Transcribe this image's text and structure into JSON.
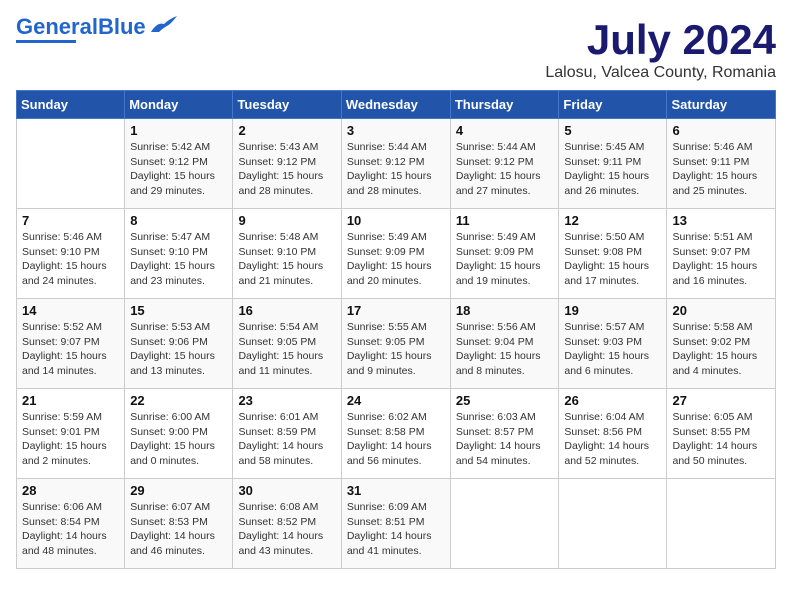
{
  "logo": {
    "text1": "General",
    "text2": "Blue"
  },
  "title": "July 2024",
  "subtitle": "Lalosu, Valcea County, Romania",
  "days_of_week": [
    "Sunday",
    "Monday",
    "Tuesday",
    "Wednesday",
    "Thursday",
    "Friday",
    "Saturday"
  ],
  "weeks": [
    [
      {
        "day": "",
        "info": ""
      },
      {
        "day": "1",
        "info": "Sunrise: 5:42 AM\nSunset: 9:12 PM\nDaylight: 15 hours\nand 29 minutes."
      },
      {
        "day": "2",
        "info": "Sunrise: 5:43 AM\nSunset: 9:12 PM\nDaylight: 15 hours\nand 28 minutes."
      },
      {
        "day": "3",
        "info": "Sunrise: 5:44 AM\nSunset: 9:12 PM\nDaylight: 15 hours\nand 28 minutes."
      },
      {
        "day": "4",
        "info": "Sunrise: 5:44 AM\nSunset: 9:12 PM\nDaylight: 15 hours\nand 27 minutes."
      },
      {
        "day": "5",
        "info": "Sunrise: 5:45 AM\nSunset: 9:11 PM\nDaylight: 15 hours\nand 26 minutes."
      },
      {
        "day": "6",
        "info": "Sunrise: 5:46 AM\nSunset: 9:11 PM\nDaylight: 15 hours\nand 25 minutes."
      }
    ],
    [
      {
        "day": "7",
        "info": "Sunrise: 5:46 AM\nSunset: 9:10 PM\nDaylight: 15 hours\nand 24 minutes."
      },
      {
        "day": "8",
        "info": "Sunrise: 5:47 AM\nSunset: 9:10 PM\nDaylight: 15 hours\nand 23 minutes."
      },
      {
        "day": "9",
        "info": "Sunrise: 5:48 AM\nSunset: 9:10 PM\nDaylight: 15 hours\nand 21 minutes."
      },
      {
        "day": "10",
        "info": "Sunrise: 5:49 AM\nSunset: 9:09 PM\nDaylight: 15 hours\nand 20 minutes."
      },
      {
        "day": "11",
        "info": "Sunrise: 5:49 AM\nSunset: 9:09 PM\nDaylight: 15 hours\nand 19 minutes."
      },
      {
        "day": "12",
        "info": "Sunrise: 5:50 AM\nSunset: 9:08 PM\nDaylight: 15 hours\nand 17 minutes."
      },
      {
        "day": "13",
        "info": "Sunrise: 5:51 AM\nSunset: 9:07 PM\nDaylight: 15 hours\nand 16 minutes."
      }
    ],
    [
      {
        "day": "14",
        "info": "Sunrise: 5:52 AM\nSunset: 9:07 PM\nDaylight: 15 hours\nand 14 minutes."
      },
      {
        "day": "15",
        "info": "Sunrise: 5:53 AM\nSunset: 9:06 PM\nDaylight: 15 hours\nand 13 minutes."
      },
      {
        "day": "16",
        "info": "Sunrise: 5:54 AM\nSunset: 9:05 PM\nDaylight: 15 hours\nand 11 minutes."
      },
      {
        "day": "17",
        "info": "Sunrise: 5:55 AM\nSunset: 9:05 PM\nDaylight: 15 hours\nand 9 minutes."
      },
      {
        "day": "18",
        "info": "Sunrise: 5:56 AM\nSunset: 9:04 PM\nDaylight: 15 hours\nand 8 minutes."
      },
      {
        "day": "19",
        "info": "Sunrise: 5:57 AM\nSunset: 9:03 PM\nDaylight: 15 hours\nand 6 minutes."
      },
      {
        "day": "20",
        "info": "Sunrise: 5:58 AM\nSunset: 9:02 PM\nDaylight: 15 hours\nand 4 minutes."
      }
    ],
    [
      {
        "day": "21",
        "info": "Sunrise: 5:59 AM\nSunset: 9:01 PM\nDaylight: 15 hours\nand 2 minutes."
      },
      {
        "day": "22",
        "info": "Sunrise: 6:00 AM\nSunset: 9:00 PM\nDaylight: 15 hours\nand 0 minutes."
      },
      {
        "day": "23",
        "info": "Sunrise: 6:01 AM\nSunset: 8:59 PM\nDaylight: 14 hours\nand 58 minutes."
      },
      {
        "day": "24",
        "info": "Sunrise: 6:02 AM\nSunset: 8:58 PM\nDaylight: 14 hours\nand 56 minutes."
      },
      {
        "day": "25",
        "info": "Sunrise: 6:03 AM\nSunset: 8:57 PM\nDaylight: 14 hours\nand 54 minutes."
      },
      {
        "day": "26",
        "info": "Sunrise: 6:04 AM\nSunset: 8:56 PM\nDaylight: 14 hours\nand 52 minutes."
      },
      {
        "day": "27",
        "info": "Sunrise: 6:05 AM\nSunset: 8:55 PM\nDaylight: 14 hours\nand 50 minutes."
      }
    ],
    [
      {
        "day": "28",
        "info": "Sunrise: 6:06 AM\nSunset: 8:54 PM\nDaylight: 14 hours\nand 48 minutes."
      },
      {
        "day": "29",
        "info": "Sunrise: 6:07 AM\nSunset: 8:53 PM\nDaylight: 14 hours\nand 46 minutes."
      },
      {
        "day": "30",
        "info": "Sunrise: 6:08 AM\nSunset: 8:52 PM\nDaylight: 14 hours\nand 43 minutes."
      },
      {
        "day": "31",
        "info": "Sunrise: 6:09 AM\nSunset: 8:51 PM\nDaylight: 14 hours\nand 41 minutes."
      },
      {
        "day": "",
        "info": ""
      },
      {
        "day": "",
        "info": ""
      },
      {
        "day": "",
        "info": ""
      }
    ]
  ]
}
